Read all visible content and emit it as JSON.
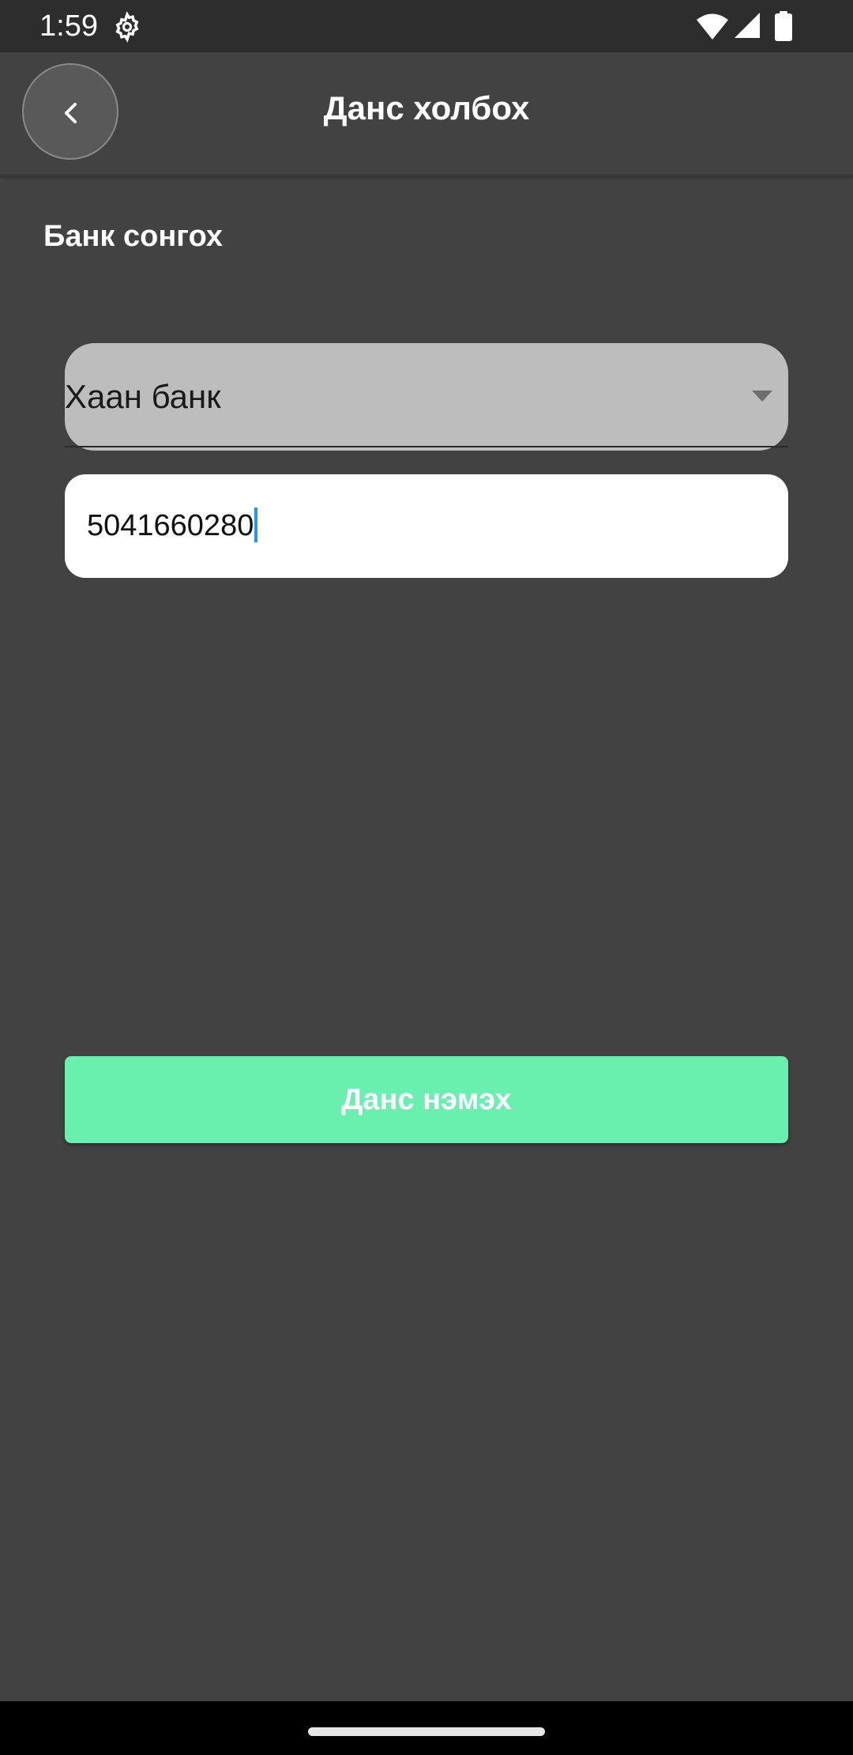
{
  "status_bar": {
    "time": "1:59",
    "icons": [
      "gear-icon",
      "wifi-icon",
      "signal-icon",
      "battery-icon"
    ]
  },
  "app_bar": {
    "title": "Данс холбох",
    "back_icon": "chevron-left-icon"
  },
  "form": {
    "bank_label": "Банк сонгох",
    "bank_select": {
      "selected": "Хаан банк",
      "icon": "dropdown-arrow-icon"
    },
    "account_input": {
      "value": "5041660280"
    },
    "submit_label": "Данс нэмэх"
  },
  "colors": {
    "background": "#424242",
    "status_bar": "#2d2d2d",
    "select_bg": "#bdbdbd",
    "input_bg": "#ffffff",
    "accent": "#69f0ae",
    "caret": "#2196f3"
  }
}
